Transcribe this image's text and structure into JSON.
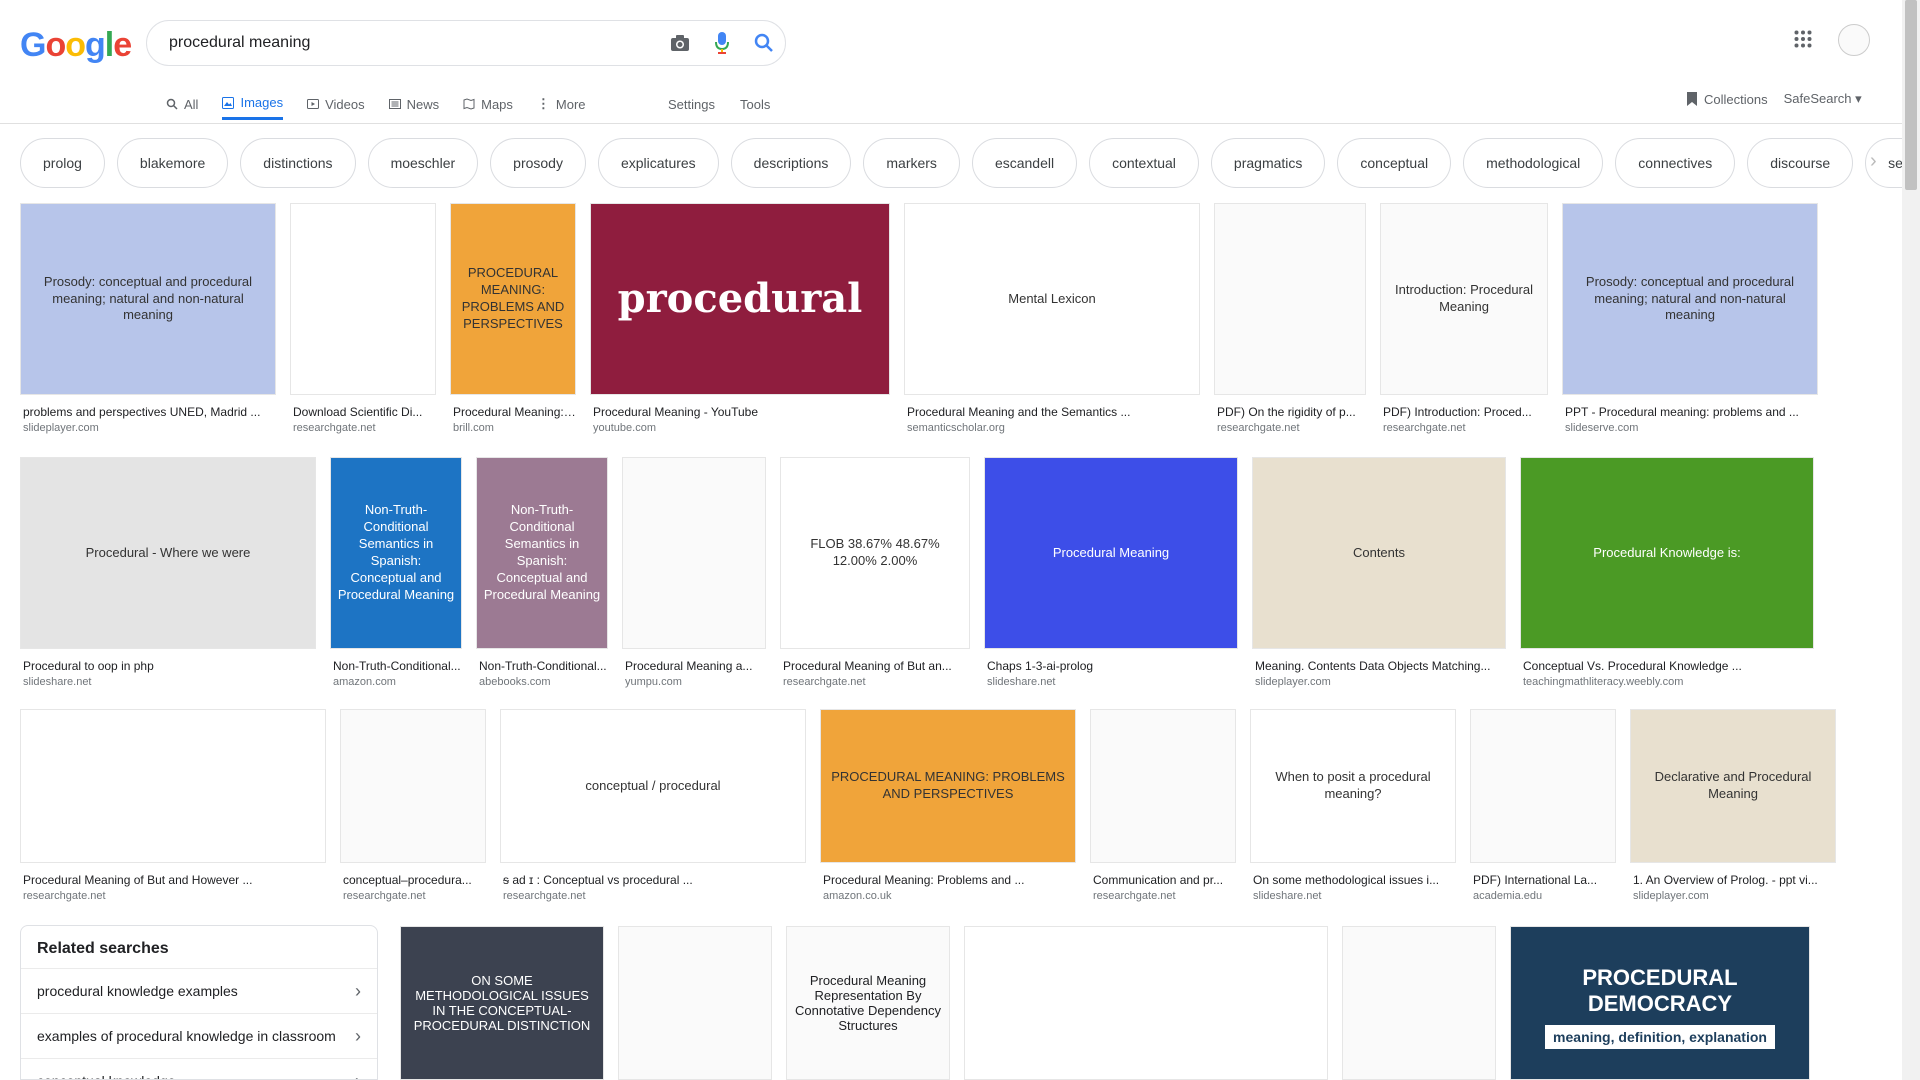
{
  "search": {
    "query": "procedural meaning"
  },
  "logo": "Google",
  "tabs": [
    {
      "label": "All",
      "icon": "search-icon"
    },
    {
      "label": "Images",
      "icon": "image-icon"
    },
    {
      "label": "Videos",
      "icon": "video-icon"
    },
    {
      "label": "News",
      "icon": "news-icon"
    },
    {
      "label": "Maps",
      "icon": "map-icon"
    },
    {
      "label": "More",
      "icon": "more-vert-icon"
    }
  ],
  "tools": {
    "settings": "Settings",
    "tools": "Tools",
    "collections": "Collections",
    "safesearch": "SafeSearch"
  },
  "chips": [
    "prolog",
    "blakemore",
    "distinctions",
    "moeschler",
    "prosody",
    "explicatures",
    "descriptions",
    "markers",
    "escandell",
    "contextual",
    "pragmatics",
    "conceptual",
    "methodological",
    "connectives",
    "discourse",
    "semantics"
  ],
  "row1": [
    {
      "caption": "problems and perspectives UNED, Madrid ...",
      "source": "slideplayer.com",
      "thumb": "Prosody: conceptual and procedural meaning; natural and non-natural meaning",
      "bg": "#b7c5ea"
    },
    {
      "caption": "Download Scientific Di...",
      "source": "researchgate.net",
      "thumb": "",
      "bg": "#ffffff"
    },
    {
      "caption": "Procedural Meaning: ...",
      "source": "brill.com",
      "thumb": "PROCEDURAL MEANING: PROBLEMS AND PERSPECTIVES",
      "bg": "#f0a43a"
    },
    {
      "caption": "Procedural Meaning - YouTube",
      "source": "youtube.com",
      "thumb": "procedural",
      "bg": "#8f1d3e"
    },
    {
      "caption": "Procedural Meaning and the Semantics ...",
      "source": "semanticscholar.org",
      "thumb": "Mental Lexicon",
      "bg": "#ffffff"
    },
    {
      "caption": "PDF) On the rigidity of p...",
      "source": "researchgate.net",
      "thumb": "",
      "bg": "#fafafa"
    },
    {
      "caption": "PDF) Introduction: Proced...",
      "source": "researchgate.net",
      "thumb": "Introduction: Procedural Meaning",
      "bg": "#fafafa"
    },
    {
      "caption": "PPT - Procedural meaning: problems and ...",
      "source": "slideserve.com",
      "thumb": "Prosody: conceptual and procedural meaning; natural and non-natural meaning",
      "bg": "#b7c5ea"
    }
  ],
  "row2": [
    {
      "caption": "Procedural to oop in php",
      "source": "slideshare.net",
      "thumb": "Procedural - Where we were",
      "bg": "#e4e4e4"
    },
    {
      "caption": "Non-Truth-Conditional...",
      "source": "amazon.com",
      "thumb": "Non-Truth-Conditional Semantics in Spanish: Conceptual and Procedural Meaning",
      "bg": "#1d74c4"
    },
    {
      "caption": "Non-Truth-Conditional...",
      "source": "abebooks.com",
      "thumb": "Non-Truth-Conditional Semantics in Spanish: Conceptual and Procedural Meaning",
      "bg": "#9c7a93"
    },
    {
      "caption": "Procedural Meaning a...",
      "source": "yumpu.com",
      "thumb": "",
      "bg": "#fafafa"
    },
    {
      "caption": "Procedural Meaning of But an...",
      "source": "researchgate.net",
      "thumb": "FLOB 38.67% 48.67% 12.00% 2.00%",
      "bg": "#ffffff"
    },
    {
      "caption": "Chaps 1-3-ai-prolog",
      "source": "slideshare.net",
      "thumb": "Procedural Meaning",
      "bg": "#3d4ee8"
    },
    {
      "caption": "Meaning. Contents Data Objects Matching...",
      "source": "slideplayer.com",
      "thumb": "Contents",
      "bg": "#e8e0cf"
    },
    {
      "caption": "Conceptual Vs. Procedural Knowledge ...",
      "source": "teachingmathliteracy.weebly.com",
      "thumb": "Procedural Knowledge is:",
      "bg": "#4b9a25"
    }
  ],
  "row3": [
    {
      "caption": "Procedural Meaning of But and However ...",
      "source": "researchgate.net",
      "thumb": "",
      "bg": "#ffffff"
    },
    {
      "caption": "conceptual–procedura...",
      "source": "researchgate.net",
      "thumb": "",
      "bg": "#fafafa"
    },
    {
      "caption": "ᵴ ad ɪ : Conceptual vs procedural ...",
      "source": "researchgate.net",
      "thumb": "conceptual / procedural",
      "bg": "#ffffff"
    },
    {
      "caption": "Procedural Meaning: Problems and ...",
      "source": "amazon.co.uk",
      "thumb": "PROCEDURAL MEANING: PROBLEMS AND PERSPECTIVES",
      "bg": "#f0a43a"
    },
    {
      "caption": "Communication and pr...",
      "source": "researchgate.net",
      "thumb": "",
      "bg": "#fafafa"
    },
    {
      "caption": "On some methodological issues i...",
      "source": "slideshare.net",
      "thumb": "When to posit a procedural meaning?",
      "bg": "#ffffff"
    },
    {
      "caption": "PDF) International La...",
      "source": "academia.edu",
      "thumb": "",
      "bg": "#fafafa"
    },
    {
      "caption": "1. An Overview of Prolog. - ppt vi...",
      "source": "slideplayer.com",
      "thumb": "Declarative and Procedural Meaning",
      "bg": "#e8e0cf"
    }
  ],
  "related": {
    "title": "Related searches",
    "items": [
      "procedural knowledge examples",
      "examples of procedural knowledge in classroom",
      "conceptual knowledge"
    ]
  },
  "row4": [
    {
      "thumb": "ON SOME METHODOLOGICAL ISSUES IN THE CONCEPTUAL-PROCEDURAL DISTINCTION",
      "bg": "#3c4250"
    },
    {
      "thumb": "",
      "bg": "#fafafa"
    },
    {
      "thumb": "Procedural Meaning Representation By Connotative Dependency Structures",
      "bg": "#fafafa"
    },
    {
      "thumb": "",
      "bg": "#ffffff"
    },
    {
      "thumb": "",
      "bg": "#fafafa"
    },
    {
      "thumb": "PROCEDURAL DEMOCRACY",
      "bg": "#1d3e5c"
    }
  ],
  "row4_extra": {
    "subtitle": "meaning, definition, explanation"
  }
}
